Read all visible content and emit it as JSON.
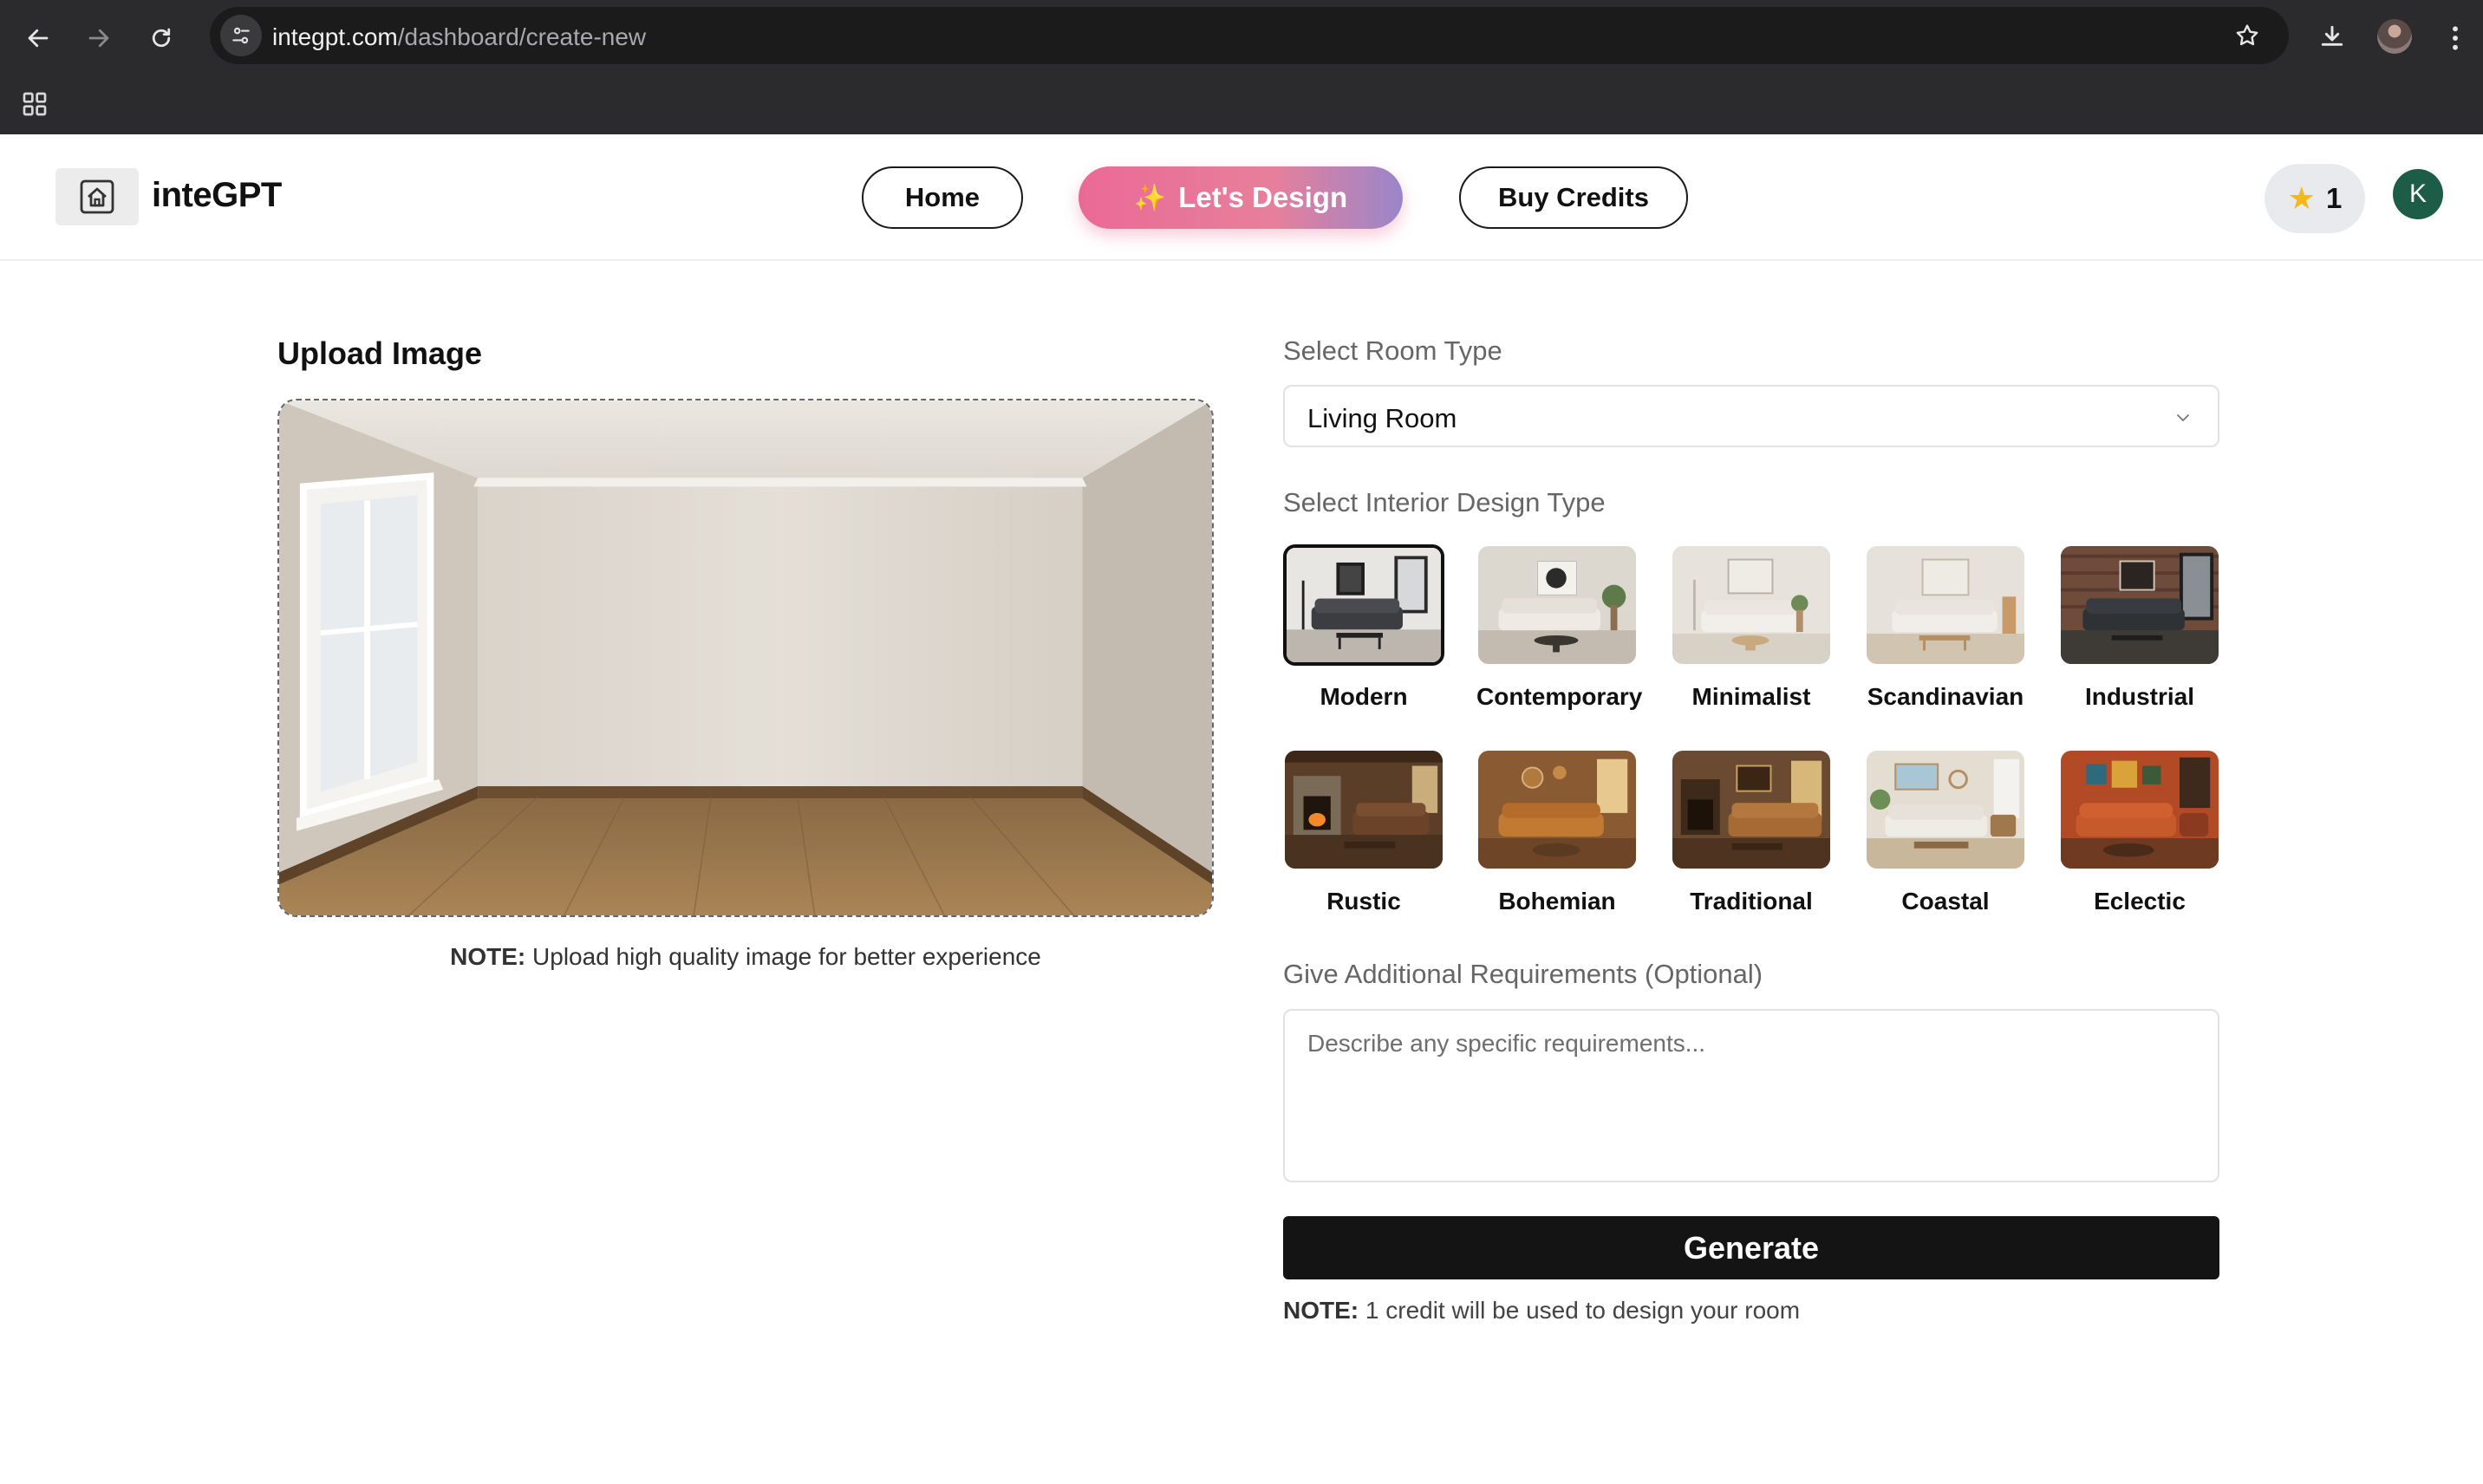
{
  "browser": {
    "url_host": "integpt.com",
    "url_path": "/dashboard/create-new"
  },
  "header": {
    "brand": "inteGPT",
    "nav": {
      "home": "Home",
      "design": "Let's Design",
      "buy": "Buy Credits"
    },
    "credits": "1",
    "avatar_initial": "K"
  },
  "upload": {
    "title": "Upload Image",
    "note_label": "NOTE:",
    "note_text": " Upload high quality image for better experience"
  },
  "form": {
    "room_type_label": "Select Room Type",
    "room_type_value": "Living Room",
    "design_type_label": "Select Interior Design Type",
    "styles": [
      {
        "name": "Modern",
        "selected": true
      },
      {
        "name": "Contemporary",
        "selected": false
      },
      {
        "name": "Minimalist",
        "selected": false
      },
      {
        "name": "Scandinavian",
        "selected": false
      },
      {
        "name": "Industrial",
        "selected": false
      },
      {
        "name": "Rustic",
        "selected": false
      },
      {
        "name": "Bohemian",
        "selected": false
      },
      {
        "name": "Traditional",
        "selected": false
      },
      {
        "name": "Coastal",
        "selected": false
      },
      {
        "name": "Eclectic",
        "selected": false
      }
    ],
    "additional_label": "Give Additional Requirements (Optional)",
    "additional_placeholder": "Describe any specific requirements...",
    "generate_label": "Generate",
    "note_label": "NOTE:",
    "note_text": " 1 credit will be used to design your room"
  },
  "colors": {
    "accent_gradient_start": "#ea6a96",
    "accent_gradient_end": "#9a86c9",
    "generate_bg": "#141414",
    "credit_star": "#f5b91e",
    "avatar_bg": "#1d5c46"
  },
  "icons": {
    "back": "back-arrow-icon",
    "forward": "forward-arrow-icon",
    "reload": "reload-icon",
    "site_info": "tune-icon",
    "bookmark": "star-outline-icon",
    "download": "download-icon",
    "menu": "kebab-menu-icon",
    "apps": "apps-grid-icon",
    "logo": "house-logo-icon",
    "dropdown": "chevron-down-icon"
  }
}
